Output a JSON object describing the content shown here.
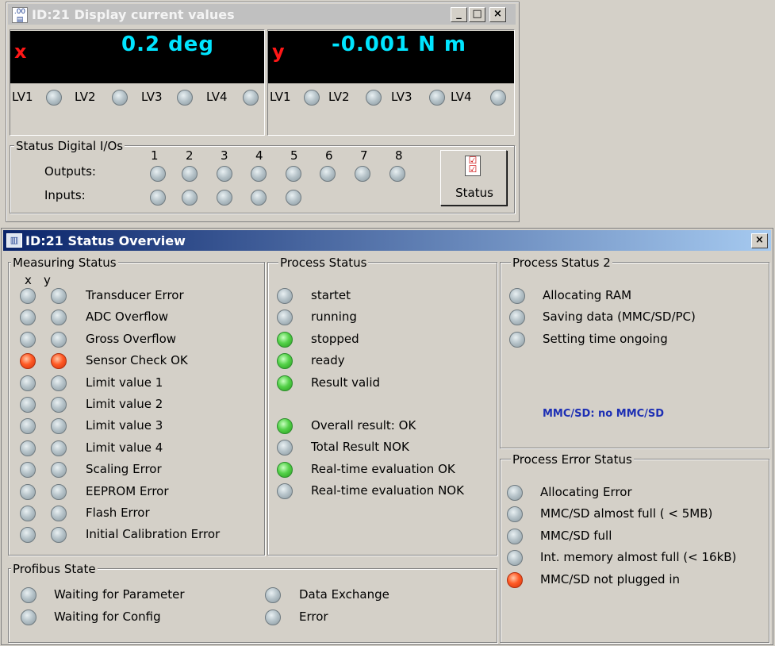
{
  "display_window": {
    "title": "ID:21   Display current values",
    "icon": "chart-document-icon",
    "channels": [
      {
        "axis": "x",
        "value": "0.2  deg",
        "limit_labels": [
          "LV1",
          "LV2",
          "LV3",
          "LV4"
        ]
      },
      {
        "axis": "y",
        "value": "-0.001  N m",
        "limit_labels": [
          "LV1",
          "LV2",
          "LV3",
          "LV4"
        ]
      }
    ],
    "digital_io": {
      "title": "Status Digital I/Os",
      "channel_numbers": [
        "1",
        "2",
        "3",
        "4",
        "5",
        "6",
        "7",
        "8"
      ],
      "outputs_label": "Outputs:",
      "inputs_label": "Inputs:",
      "status_button": "Status"
    },
    "window_buttons": {
      "minimize": "_",
      "maximize": "□",
      "close": "×"
    }
  },
  "status_window": {
    "title": "ID:21   Status Overview",
    "close": "×",
    "measuring_status": {
      "title": "Measuring Status",
      "col_x": "x",
      "col_y": "y",
      "items": [
        {
          "label": "Transducer Error",
          "x": "gray",
          "y": "gray"
        },
        {
          "label": "ADC Overflow",
          "x": "gray",
          "y": "gray"
        },
        {
          "label": "Gross Overflow",
          "x": "gray",
          "y": "gray"
        },
        {
          "label": "Sensor Check OK",
          "x": "red",
          "y": "red"
        },
        {
          "label": "Limit value 1",
          "x": "gray",
          "y": "gray"
        },
        {
          "label": "Limit value 2",
          "x": "gray",
          "y": "gray"
        },
        {
          "label": "Limit value 3",
          "x": "gray",
          "y": "gray"
        },
        {
          "label": "Limit value 4",
          "x": "gray",
          "y": "gray"
        },
        {
          "label": "Scaling Error",
          "x": "gray",
          "y": "gray"
        },
        {
          "label": "EEPROM Error",
          "x": "gray",
          "y": "gray"
        },
        {
          "label": "Flash Error",
          "x": "gray",
          "y": "gray"
        },
        {
          "label": "Initial Calibration Error",
          "x": "gray",
          "y": "gray"
        }
      ]
    },
    "process_status": {
      "title": "Process Status",
      "items": [
        {
          "label": "startet",
          "state": "gray"
        },
        {
          "label": "running",
          "state": "gray"
        },
        {
          "label": "stopped",
          "state": "green"
        },
        {
          "label": "ready",
          "state": "green"
        },
        {
          "label": "Result valid",
          "state": "green"
        },
        {
          "label": "Overall result: OK",
          "state": "green"
        },
        {
          "label": "Total Result NOK",
          "state": "gray"
        },
        {
          "label": "Real-time evaluation OK",
          "state": "green"
        },
        {
          "label": "Real-time evaluation NOK",
          "state": "gray"
        }
      ]
    },
    "process_status_2": {
      "title": "Process Status 2",
      "items": [
        {
          "label": "Allocating RAM",
          "state": "gray"
        },
        {
          "label": "Saving data (MMC/SD/PC)",
          "state": "gray"
        },
        {
          "label": "Setting time ongoing",
          "state": "gray"
        }
      ],
      "mmc_info": "MMC/SD: no MMC/SD"
    },
    "process_error_status": {
      "title": "Process Error Status",
      "items": [
        {
          "label": "Allocating Error",
          "state": "gray"
        },
        {
          "label": "MMC/SD almost full ( < 5MB)",
          "state": "gray"
        },
        {
          "label": "MMC/SD full",
          "state": "gray"
        },
        {
          "label": "Int. memory almost full (< 16kB)",
          "state": "gray"
        },
        {
          "label": "MMC/SD not plugged in",
          "state": "red"
        }
      ]
    },
    "profibus_state": {
      "title": "Profibus State",
      "items": [
        {
          "label": "Waiting for Parameter",
          "state": "gray"
        },
        {
          "label": "Waiting for Config",
          "state": "gray"
        },
        {
          "label": "Data Exchange",
          "state": "gray"
        },
        {
          "label": "Error",
          "state": "gray"
        }
      ]
    }
  },
  "colors": {
    "value_cyan": "#00e5ff",
    "axis_red": "#ff1717",
    "led_green": "#55d24a",
    "led_red": "#ff5a25",
    "mmc_blue": "#1d2fb4"
  }
}
